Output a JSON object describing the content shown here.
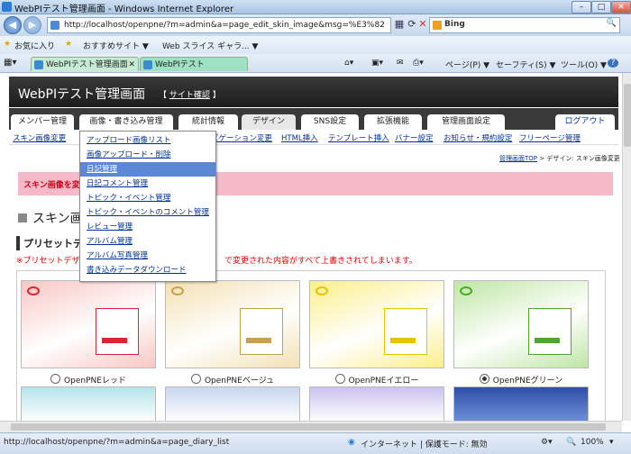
{
  "window": {
    "title": "WebPIテスト管理画面 - Windows Internet Explorer"
  },
  "address": {
    "url": "http://localhost/openpne/?m=admin&a=page_edit_skin_image&msg=%E3%82",
    "search_label": "Bing"
  },
  "favorites": {
    "label": "お気に入り",
    "items": [
      "おすすめサイト ▼",
      "Web スライス ギャラ... ▼"
    ]
  },
  "tabs": [
    {
      "label": "WebPIテスト管理画面"
    },
    {
      "label": "WebPIテスト"
    }
  ],
  "command_bar": {
    "page": "ページ(P) ▼",
    "safety": "セーフティ(S) ▼",
    "tools": "ツール(O) ▼",
    "help": "?"
  },
  "header": {
    "title": "WebPIテスト管理画面",
    "site_link": "サイト確認"
  },
  "menu": [
    {
      "label": "メンバー管理"
    },
    {
      "label": "画像・書き込み管理"
    },
    {
      "label": "統計情報"
    },
    {
      "label": "デザイン"
    },
    {
      "label": "SNS設定"
    },
    {
      "label": "拡張機能"
    },
    {
      "label": "管理画面設定"
    }
  ],
  "logout": "ログアウト",
  "subnav": [
    "スキン画像変更",
    "ビゲーション変更",
    "HTML挿入",
    "テンプレート挿入",
    "バナー設定",
    "お知らせ・規約設定",
    "フリーページ管理"
  ],
  "breadcrumb": {
    "link": "管理画面TOP",
    "current": "> デザイン: スキン画像変更"
  },
  "alert": "スキン画像を変",
  "heading": "スキン画",
  "subheading": "プリセットデ",
  "warning": "※プリセットデザイ",
  "warning_tail": "で変更された内容がすべて上書きされてしまいます。",
  "skins": [
    {
      "name": "OpenPNEレッド",
      "selected": false,
      "color": "#d9262f",
      "bg": "#f8c7c3"
    },
    {
      "name": "OpenPNEベージュ",
      "selected": false,
      "color": "#c8a14a",
      "bg": "#f3e1b4"
    },
    {
      "name": "OpenPNEイエロー",
      "selected": false,
      "color": "#e8c200",
      "bg": "#fbef8a"
    },
    {
      "name": "OpenPNEグリーン",
      "selected": true,
      "color": "#4aa82a",
      "bg": "#bfe6a5"
    }
  ],
  "dropdown": [
    {
      "label": "アップロード画像リスト",
      "highlight": false
    },
    {
      "label": "画像アップロード・削除",
      "highlight": false
    },
    {
      "label": "日記管理",
      "highlight": true
    },
    {
      "label": "日記コメント管理",
      "highlight": false
    },
    {
      "label": "トピック・イベント管理",
      "highlight": false
    },
    {
      "label": "トピック・イベントのコメント管理",
      "highlight": false
    },
    {
      "label": "レビュー管理",
      "highlight": false
    },
    {
      "label": "アルバム管理",
      "highlight": false
    },
    {
      "label": "アルバム写真管理",
      "highlight": false
    },
    {
      "label": "書き込みデータダウンロード",
      "highlight": false
    }
  ],
  "status": {
    "url": "http://localhost/openpne/?m=admin&a=page_diary_list",
    "zone": "インターネット | 保護モード: 無効",
    "zoom": "100%"
  }
}
